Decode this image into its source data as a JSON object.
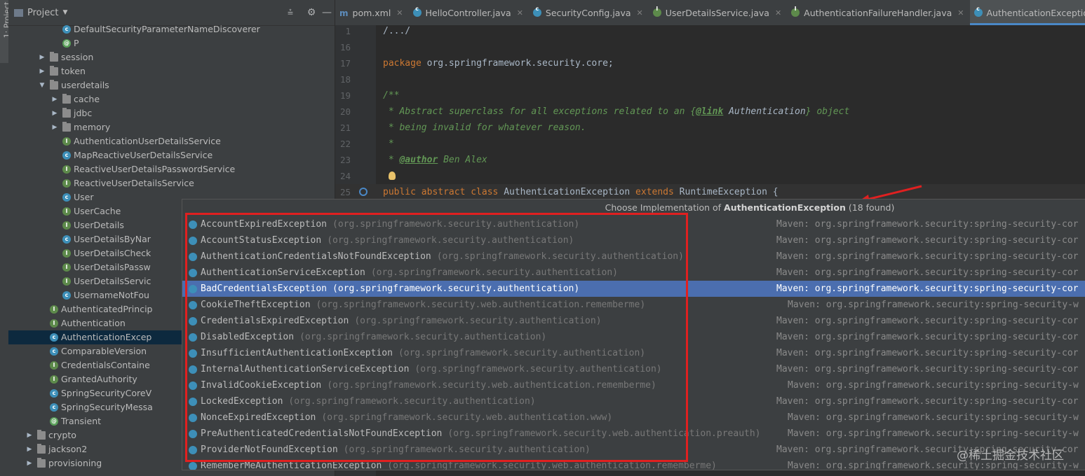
{
  "sidebar_strip": {
    "label": "1: Project"
  },
  "project": {
    "title": "Project",
    "tree": [
      {
        "label": "DefaultSecurityParameterNameDiscoverer",
        "icon": "class",
        "depth": 3,
        "arrow": ""
      },
      {
        "label": "P",
        "icon": "annotation",
        "depth": 3,
        "arrow": ""
      },
      {
        "label": "session",
        "icon": "folder",
        "depth": 2,
        "arrow": "▶"
      },
      {
        "label": "token",
        "icon": "folder",
        "depth": 2,
        "arrow": "▶"
      },
      {
        "label": "userdetails",
        "icon": "folder",
        "depth": 2,
        "arrow": "▼"
      },
      {
        "label": "cache",
        "icon": "folder",
        "depth": 3,
        "arrow": "▶"
      },
      {
        "label": "jdbc",
        "icon": "folder",
        "depth": 3,
        "arrow": "▶"
      },
      {
        "label": "memory",
        "icon": "folder",
        "depth": 3,
        "arrow": "▶"
      },
      {
        "label": "AuthenticationUserDetailsService",
        "icon": "interface",
        "depth": 3,
        "arrow": ""
      },
      {
        "label": "MapReactiveUserDetailsService",
        "icon": "class",
        "depth": 3,
        "arrow": ""
      },
      {
        "label": "ReactiveUserDetailsPasswordService",
        "icon": "interface",
        "depth": 3,
        "arrow": ""
      },
      {
        "label": "ReactiveUserDetailsService",
        "icon": "interface",
        "depth": 3,
        "arrow": ""
      },
      {
        "label": "User",
        "icon": "class",
        "depth": 3,
        "arrow": ""
      },
      {
        "label": "UserCache",
        "icon": "interface",
        "depth": 3,
        "arrow": ""
      },
      {
        "label": "UserDetails",
        "icon": "interface",
        "depth": 3,
        "arrow": ""
      },
      {
        "label": "UserDetailsByNar",
        "icon": "class",
        "depth": 3,
        "arrow": ""
      },
      {
        "label": "UserDetailsCheck",
        "icon": "interface",
        "depth": 3,
        "arrow": ""
      },
      {
        "label": "UserDetailsPassw",
        "icon": "interface",
        "depth": 3,
        "arrow": ""
      },
      {
        "label": "UserDetailsServic",
        "icon": "interface",
        "depth": 3,
        "arrow": ""
      },
      {
        "label": "UsernameNotFou",
        "icon": "class",
        "depth": 3,
        "arrow": ""
      },
      {
        "label": "AuthenticatedPrincip",
        "icon": "interface",
        "depth": 2,
        "arrow": ""
      },
      {
        "label": "Authentication",
        "icon": "interface",
        "depth": 2,
        "arrow": ""
      },
      {
        "label": "AuthenticationExcep",
        "icon": "class",
        "depth": 2,
        "arrow": "",
        "selected": true
      },
      {
        "label": "ComparableVersion",
        "icon": "class",
        "depth": 2,
        "arrow": ""
      },
      {
        "label": "CredentialsContaine",
        "icon": "interface",
        "depth": 2,
        "arrow": ""
      },
      {
        "label": "GrantedAuthority",
        "icon": "interface",
        "depth": 2,
        "arrow": ""
      },
      {
        "label": "SpringSecurityCoreV",
        "icon": "class",
        "depth": 2,
        "arrow": ""
      },
      {
        "label": "SpringSecurityMessa",
        "icon": "class",
        "depth": 2,
        "arrow": ""
      },
      {
        "label": "Transient",
        "icon": "annotation",
        "depth": 2,
        "arrow": ""
      },
      {
        "label": "crypto",
        "icon": "folder",
        "depth": 1,
        "arrow": "▶"
      },
      {
        "label": "jackson2",
        "icon": "folder",
        "depth": 1,
        "arrow": "▶"
      },
      {
        "label": "provisioning",
        "icon": "folder",
        "depth": 1,
        "arrow": "▶"
      }
    ]
  },
  "tabs": [
    {
      "label": "pom.xml",
      "icon": "m",
      "active": false
    },
    {
      "label": "HelloController.java",
      "icon": "class",
      "active": false
    },
    {
      "label": "SecurityConfig.java",
      "icon": "class",
      "active": false
    },
    {
      "label": "UserDetailsService.java",
      "icon": "interface",
      "active": false
    },
    {
      "label": "AuthenticationFailureHandler.java",
      "icon": "interface",
      "active": false
    },
    {
      "label": "AuthenticationException.java",
      "icon": "class",
      "active": true
    }
  ],
  "editor": {
    "lines": [
      {
        "n": "1",
        "html": "<span class='fold'>/.../</span>"
      },
      {
        "n": "16",
        "html": ""
      },
      {
        "n": "17",
        "html": "<span class='kw'>package</span> org.springframework.security.core;"
      },
      {
        "n": "18",
        "html": ""
      },
      {
        "n": "19",
        "html": "<span class='cm'>/**</span>"
      },
      {
        "n": "20",
        "html": "<span class='cm'> * Abstract superclass for all exceptions related to an {</span><span class='tag'>@link</span><span class='cm'> </span><span class='cls' style='font-style:italic'>Authentication</span><span class='cm'>} object</span>"
      },
      {
        "n": "21",
        "html": "<span class='cm'> * being invalid for whatever reason.</span>"
      },
      {
        "n": "22",
        "html": "<span class='cm'> *</span>"
      },
      {
        "n": "23",
        "html": "<span class='cm'> * </span><span class='tag'>@author</span><span class='cm'> Ben Alex</span>"
      },
      {
        "n": "24",
        "html": ""
      },
      {
        "n": "25",
        "html": "<span class='kw'>public abstract class</span> AuthenticationException <span class='kw'>extends</span> RuntimeException {"
      }
    ]
  },
  "popup": {
    "title_prefix": "Choose Implementation of ",
    "title_class": "AuthenticationException",
    "title_suffix": " (18 found)",
    "items": [
      {
        "name": "AccountExpiredException",
        "pkg": "(org.springframework.security.authentication)",
        "maven": "Maven: org.springframework.security:spring-security-cor"
      },
      {
        "name": "AccountStatusException",
        "pkg": "(org.springframework.security.authentication)",
        "maven": "Maven: org.springframework.security:spring-security-cor"
      },
      {
        "name": "AuthenticationCredentialsNotFoundException",
        "pkg": "(org.springframework.security.authentication)",
        "maven": "Maven: org.springframework.security:spring-security-cor"
      },
      {
        "name": "AuthenticationServiceException",
        "pkg": "(org.springframework.security.authentication)",
        "maven": "Maven: org.springframework.security:spring-security-cor"
      },
      {
        "name": "BadCredentialsException",
        "pkg": "(org.springframework.security.authentication)",
        "maven": "Maven: org.springframework.security:spring-security-cor",
        "selected": true
      },
      {
        "name": "CookieTheftException",
        "pkg": "(org.springframework.security.web.authentication.rememberme)",
        "maven": "Maven: org.springframework.security:spring-security-w"
      },
      {
        "name": "CredentialsExpiredException",
        "pkg": "(org.springframework.security.authentication)",
        "maven": "Maven: org.springframework.security:spring-security-cor"
      },
      {
        "name": "DisabledException",
        "pkg": "(org.springframework.security.authentication)",
        "maven": "Maven: org.springframework.security:spring-security-cor"
      },
      {
        "name": "InsufficientAuthenticationException",
        "pkg": "(org.springframework.security.authentication)",
        "maven": "Maven: org.springframework.security:spring-security-cor"
      },
      {
        "name": "InternalAuthenticationServiceException",
        "pkg": "(org.springframework.security.authentication)",
        "maven": "Maven: org.springframework.security:spring-security-cor"
      },
      {
        "name": "InvalidCookieException",
        "pkg": "(org.springframework.security.web.authentication.rememberme)",
        "maven": "Maven: org.springframework.security:spring-security-w"
      },
      {
        "name": "LockedException",
        "pkg": "(org.springframework.security.authentication)",
        "maven": "Maven: org.springframework.security:spring-security-cor"
      },
      {
        "name": "NonceExpiredException",
        "pkg": "(org.springframework.security.web.authentication.www)",
        "maven": "Maven: org.springframework.security:spring-security-w"
      },
      {
        "name": "PreAuthenticatedCredentialsNotFoundException",
        "pkg": "(org.springframework.security.web.authentication.preauth)",
        "maven": "Maven: org.springframework.security:spring-security-w"
      },
      {
        "name": "ProviderNotFoundException",
        "pkg": "(org.springframework.security.authentication)",
        "maven": "Maven: org.springframework.security:spring-security-cor"
      },
      {
        "name": "RememberMeAuthenticationException",
        "pkg": "(org.springframework.security.web.authentication.rememberme)",
        "maven": "Maven: org.springframework.security:spring-security-w"
      }
    ]
  },
  "watermark": "@稀土掘金技术社区",
  "colors": {
    "accent": "#4a88c7",
    "selection": "#4b6eaf",
    "highlight_box": "#e02020"
  }
}
